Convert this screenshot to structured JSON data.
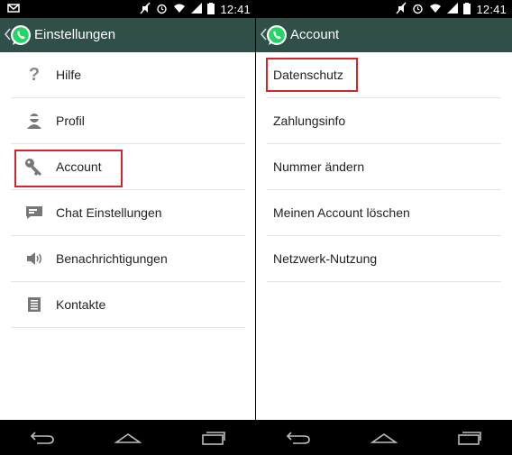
{
  "status": {
    "time": "12:41"
  },
  "left": {
    "title": "Einstellungen",
    "items": [
      {
        "label": "Hilfe",
        "icon": "help-icon"
      },
      {
        "label": "Profil",
        "icon": "profile-icon"
      },
      {
        "label": "Account",
        "icon": "key-icon"
      },
      {
        "label": "Chat Einstellungen",
        "icon": "chat-icon"
      },
      {
        "label": "Benachrichtigungen",
        "icon": "speaker-icon"
      },
      {
        "label": "Kontakte",
        "icon": "contacts-icon"
      }
    ]
  },
  "right": {
    "title": "Account",
    "items": [
      {
        "label": "Datenschutz"
      },
      {
        "label": "Zahlungsinfo"
      },
      {
        "label": "Nummer ändern"
      },
      {
        "label": "Meinen Account löschen"
      },
      {
        "label": "Netzwerk-Nutzung"
      }
    ]
  },
  "colors": {
    "actionbar": "#2f4f48",
    "highlight": "#d8232a",
    "whatsapp": "#25d366"
  }
}
